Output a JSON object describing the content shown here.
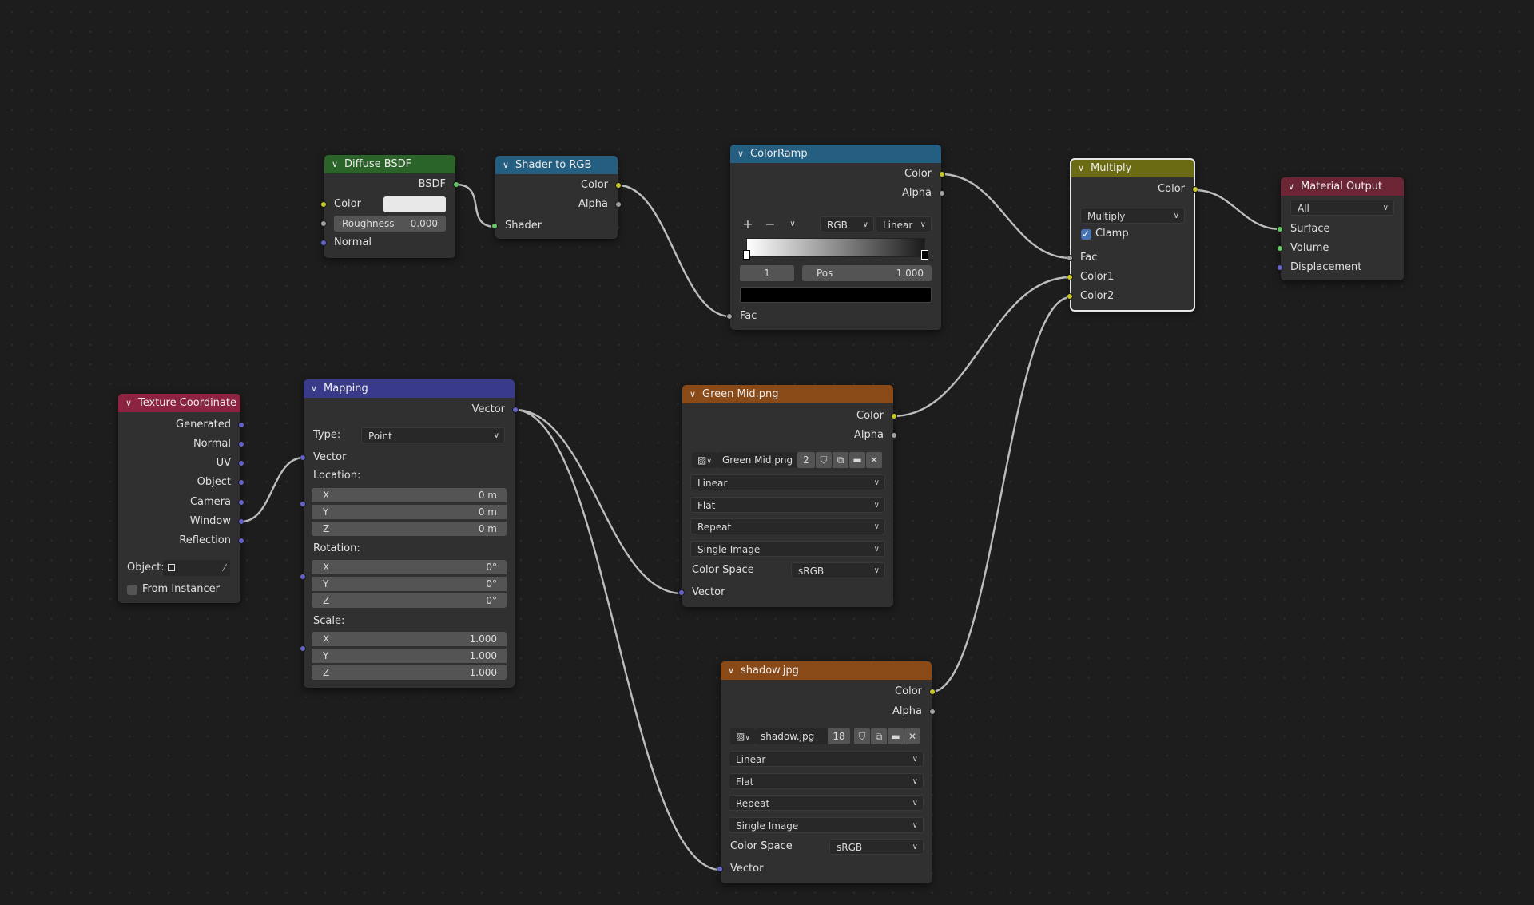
{
  "colors": {
    "diffuse_header": "#2b6429",
    "shader_to_rgb_header": "#245e80",
    "colorramp_header": "#245e80",
    "multiply_header": "#6b6b14",
    "material_output_header": "#6b2535",
    "texcoord_header": "#8c2340",
    "mapping_header": "#3a3a8a",
    "image_header": "#8a4a18",
    "socket_color": "#c7c729",
    "socket_shader": "#63c763",
    "socket_float": "#a1a1a1",
    "socket_vector": "#6363c7",
    "link": "#bdbdbd"
  },
  "diffuse": {
    "title": "Diffuse BSDF",
    "out_bsdf": "BSDF",
    "in_color": "Color",
    "roughness_label": "Roughness",
    "roughness_value": "0.000",
    "in_normal": "Normal",
    "color_swatch": "#e8e8e8"
  },
  "shader_to_rgb": {
    "title": "Shader to RGB",
    "out_color": "Color",
    "out_alpha": "Alpha",
    "in_shader": "Shader"
  },
  "colorramp": {
    "title": "ColorRamp",
    "out_color": "Color",
    "out_alpha": "Alpha",
    "add_icon": "+",
    "remove_icon": "−",
    "menu_icon": "chevron-down",
    "mode": "RGB",
    "interpolation": "Linear",
    "index": "1",
    "pos_label": "Pos",
    "pos_value": "1.000",
    "stop_color": "#000000",
    "in_fac": "Fac"
  },
  "multiply": {
    "title": "Multiply",
    "out_color": "Color",
    "blend_mode": "Multiply",
    "clamp_label": "Clamp",
    "clamp_checked": true,
    "in_fac": "Fac",
    "in_color1": "Color1",
    "in_color2": "Color2"
  },
  "material_output": {
    "title": "Material Output",
    "target": "All",
    "in_surface": "Surface",
    "in_volume": "Volume",
    "in_displacement": "Displacement"
  },
  "texcoord": {
    "title": "Texture Coordinate",
    "outputs": [
      "Generated",
      "Normal",
      "UV",
      "Object",
      "Camera",
      "Window",
      "Reflection"
    ],
    "object_label": "Object:",
    "from_instancer": "From Instancer"
  },
  "mapping": {
    "title": "Mapping",
    "out_vector": "Vector",
    "type_label": "Type:",
    "type_value": "Point",
    "in_vector": "Vector",
    "location_label": "Location:",
    "location": [
      {
        "axis": "X",
        "value": "0 m"
      },
      {
        "axis": "Y",
        "value": "0 m"
      },
      {
        "axis": "Z",
        "value": "0 m"
      }
    ],
    "rotation_label": "Rotation:",
    "rotation": [
      {
        "axis": "X",
        "value": "0°"
      },
      {
        "axis": "Y",
        "value": "0°"
      },
      {
        "axis": "Z",
        "value": "0°"
      }
    ],
    "scale_label": "Scale:",
    "scale": [
      {
        "axis": "X",
        "value": "1.000"
      },
      {
        "axis": "Y",
        "value": "1.000"
      },
      {
        "axis": "Z",
        "value": "1.000"
      }
    ]
  },
  "green": {
    "title": "Green Mid.png",
    "out_color": "Color",
    "out_alpha": "Alpha",
    "image_name": "Green Mid.png",
    "users": "2",
    "interpolation": "Linear",
    "projection": "Flat",
    "extension": "Repeat",
    "source": "Single Image",
    "colorspace_label": "Color Space",
    "colorspace": "sRGB",
    "in_vector": "Vector"
  },
  "shadow": {
    "title": "shadow.jpg",
    "out_color": "Color",
    "out_alpha": "Alpha",
    "image_name": "shadow.jpg",
    "users": "18",
    "interpolation": "Linear",
    "projection": "Flat",
    "extension": "Repeat",
    "source": "Single Image",
    "colorspace_label": "Color Space",
    "colorspace": "sRGB",
    "in_vector": "Vector"
  }
}
